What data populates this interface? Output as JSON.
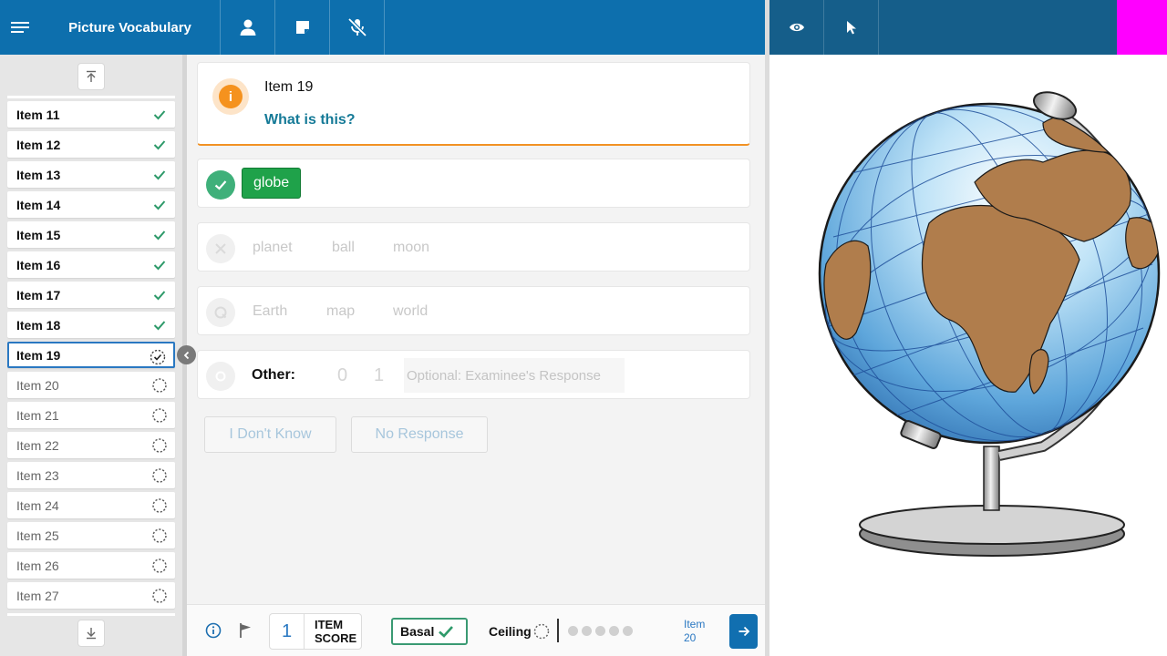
{
  "header": {
    "title": "Picture Vocabulary",
    "menu_icon": "hamburger-menu-icon",
    "buttons": [
      "examinee-icon",
      "notes-icon",
      "microphone-off-icon"
    ],
    "right_buttons": [
      "eye-icon",
      "pointer-icon"
    ],
    "accent": "#0d6fad"
  },
  "sidebar": {
    "items": [
      {
        "label": "Item 11",
        "status": "completed"
      },
      {
        "label": "Item 12",
        "status": "completed"
      },
      {
        "label": "Item 13",
        "status": "completed"
      },
      {
        "label": "Item 14",
        "status": "completed"
      },
      {
        "label": "Item 15",
        "status": "completed"
      },
      {
        "label": "Item 16",
        "status": "completed"
      },
      {
        "label": "Item 17",
        "status": "completed"
      },
      {
        "label": "Item 18",
        "status": "completed"
      },
      {
        "label": "Item 19",
        "status": "current"
      },
      {
        "label": "Item 20",
        "status": "pending"
      },
      {
        "label": "Item 21",
        "status": "pending"
      },
      {
        "label": "Item 22",
        "status": "pending"
      },
      {
        "label": "Item 23",
        "status": "pending"
      },
      {
        "label": "Item 24",
        "status": "pending"
      },
      {
        "label": "Item 25",
        "status": "pending"
      },
      {
        "label": "Item 26",
        "status": "pending"
      },
      {
        "label": "Item 27",
        "status": "pending"
      }
    ]
  },
  "question": {
    "item_label": "Item 19",
    "prompt": "What is this?"
  },
  "options": {
    "correct": [
      "globe"
    ],
    "incorrect": [
      "planet",
      "ball",
      "moon"
    ],
    "query": [
      "Earth",
      "map",
      "world"
    ],
    "other_label": "Other:",
    "other_scores": [
      "0",
      "1"
    ],
    "other_placeholder": "Optional: Examinee's Response"
  },
  "buttons": {
    "dont_know": "I Don't Know",
    "no_response": "No Response"
  },
  "footer": {
    "item_score": "1",
    "item_score_line1": "ITEM",
    "item_score_line2": "SCORE",
    "basal": "Basal",
    "ceiling": "Ceiling",
    "ceiling_progress": 0,
    "ceiling_total": 5,
    "next_line1": "Item",
    "next_line2": "20"
  }
}
